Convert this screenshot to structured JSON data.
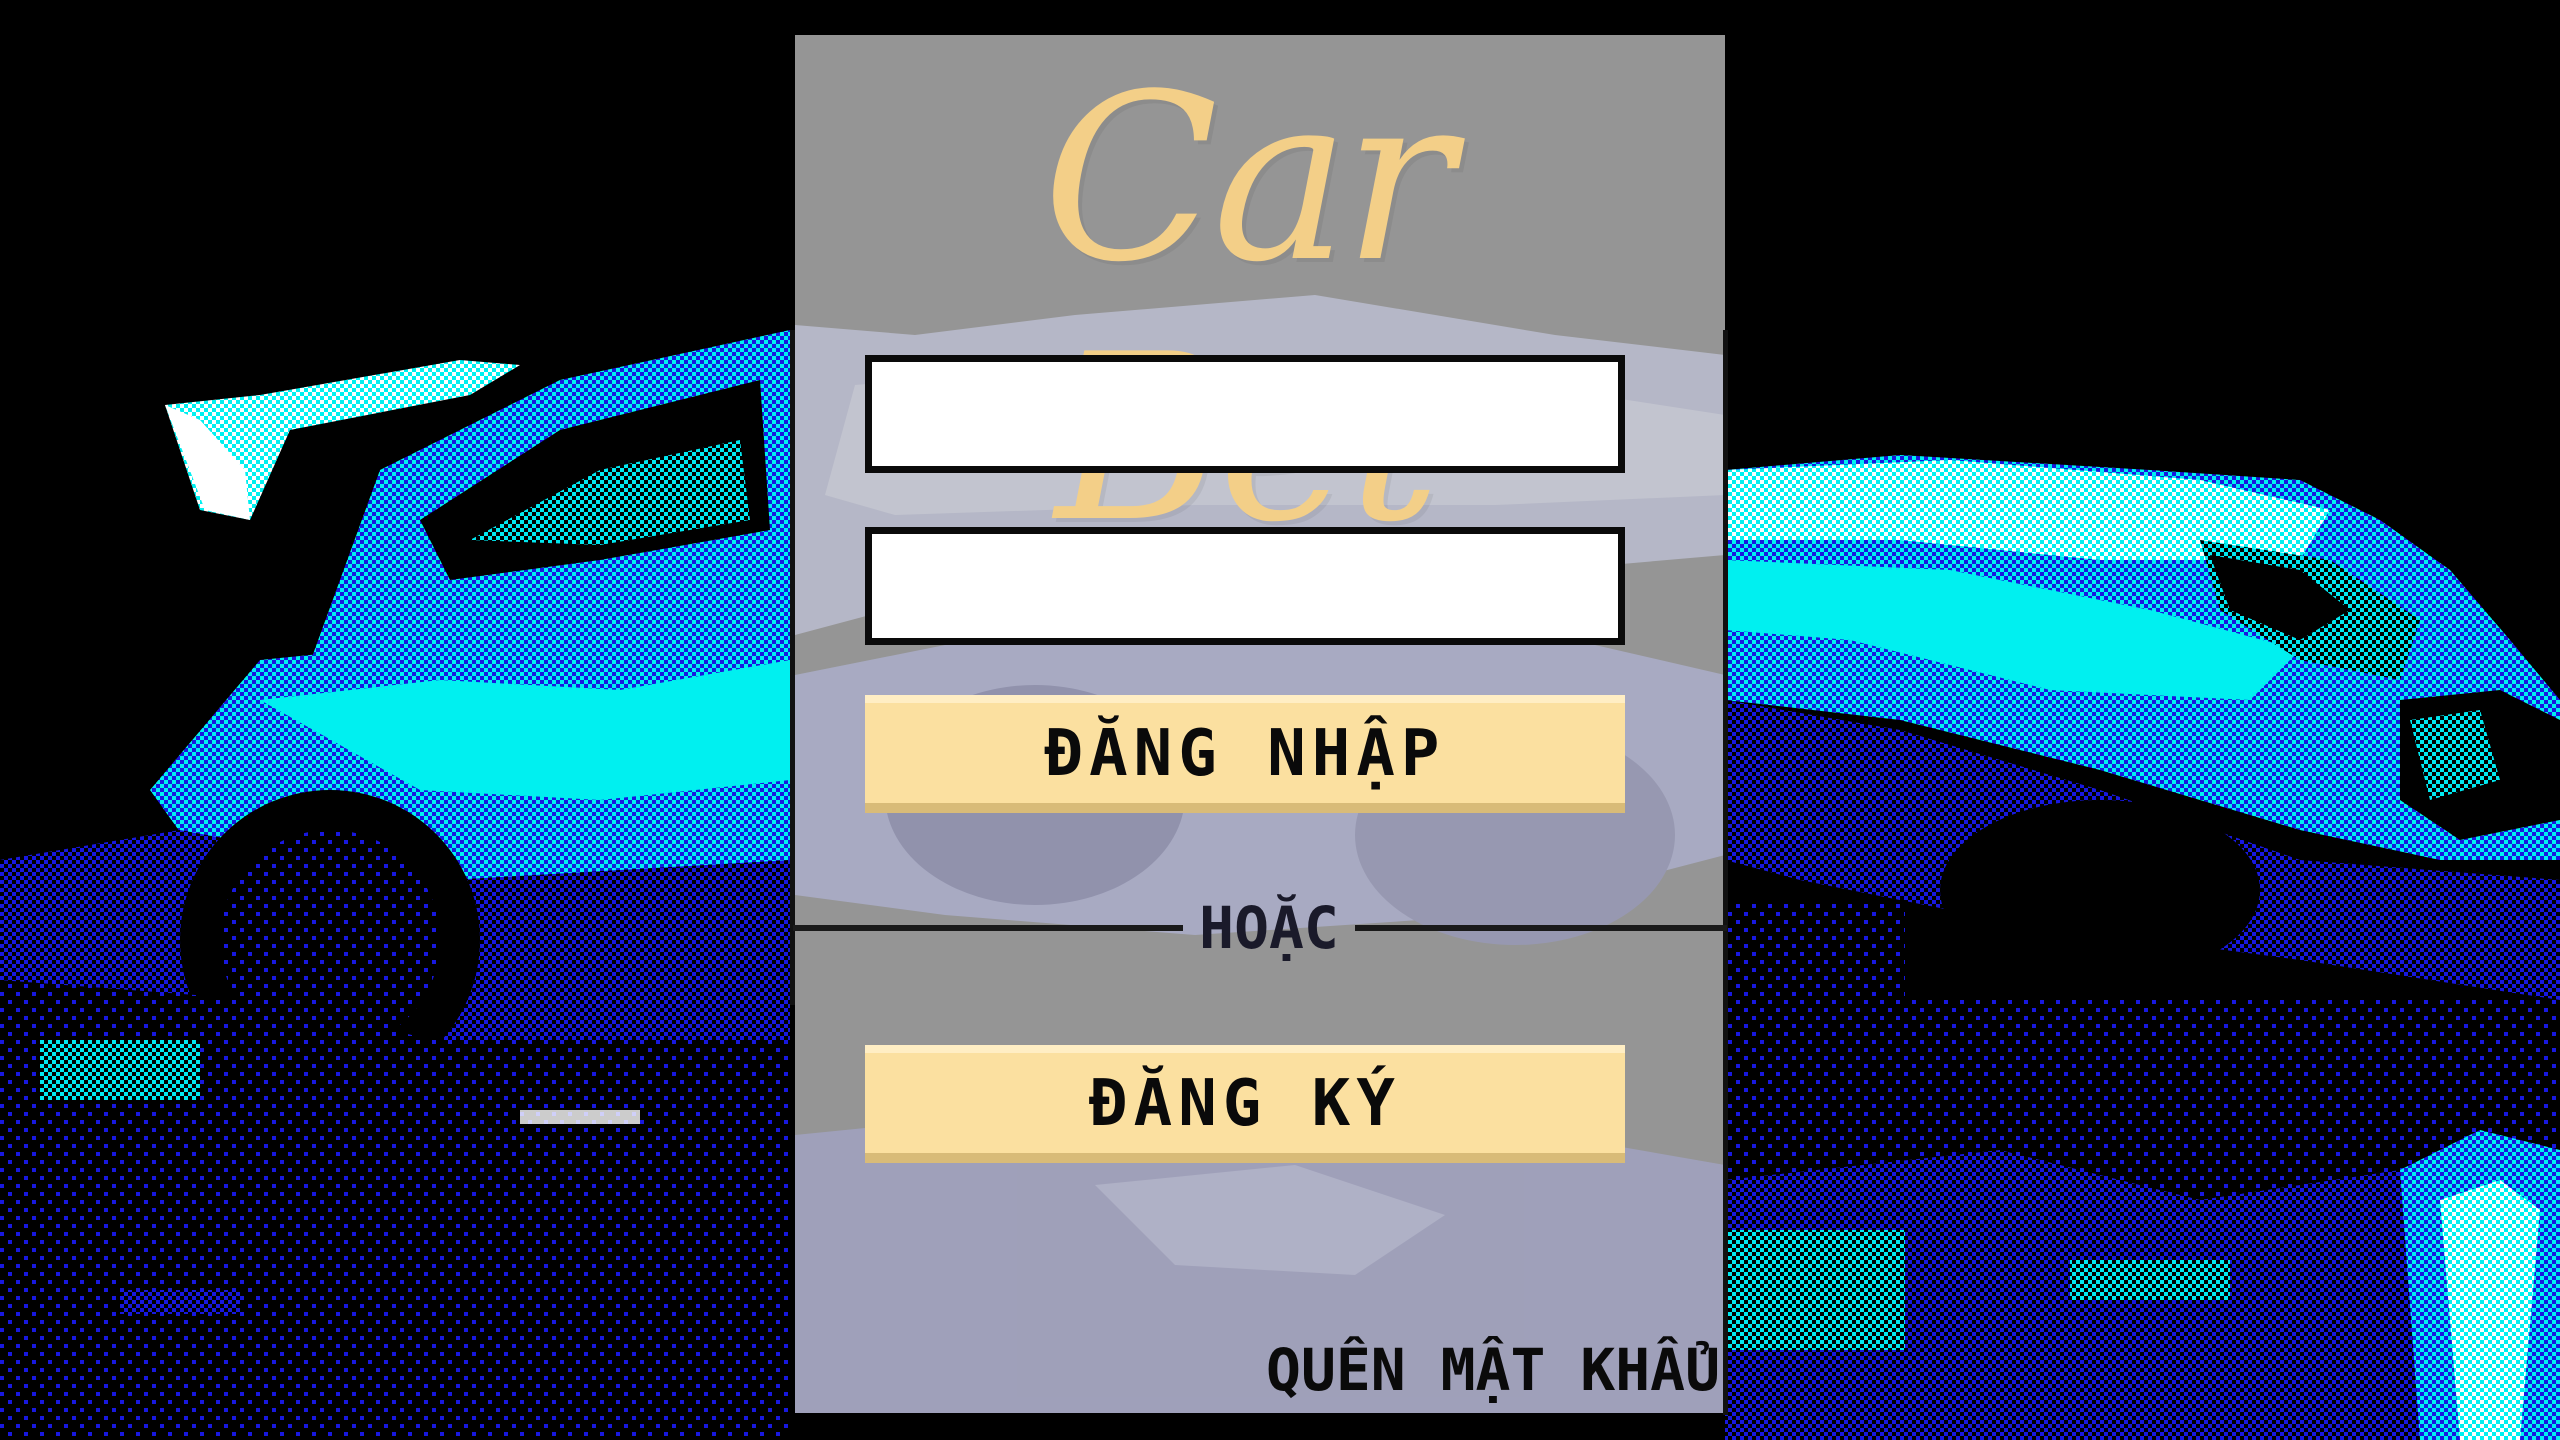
{
  "app": {
    "logo_text": "Car Bet"
  },
  "login_form": {
    "username_value": "",
    "password_value": "",
    "login_button_label": "ĐĂNG NHẬP",
    "divider_label": "HOẶC",
    "register_button_label": "ĐĂNG KÝ",
    "forgot_password_label": "QUÊN MẬT KHẨU"
  },
  "colors": {
    "background": "#000000",
    "panel": "#a0a0a0",
    "logo": "#f3cf88",
    "button": "#fbe0a0",
    "car_cyan": "#00f0f0",
    "car_blue": "#1010e8",
    "car_white": "#ffffff"
  }
}
